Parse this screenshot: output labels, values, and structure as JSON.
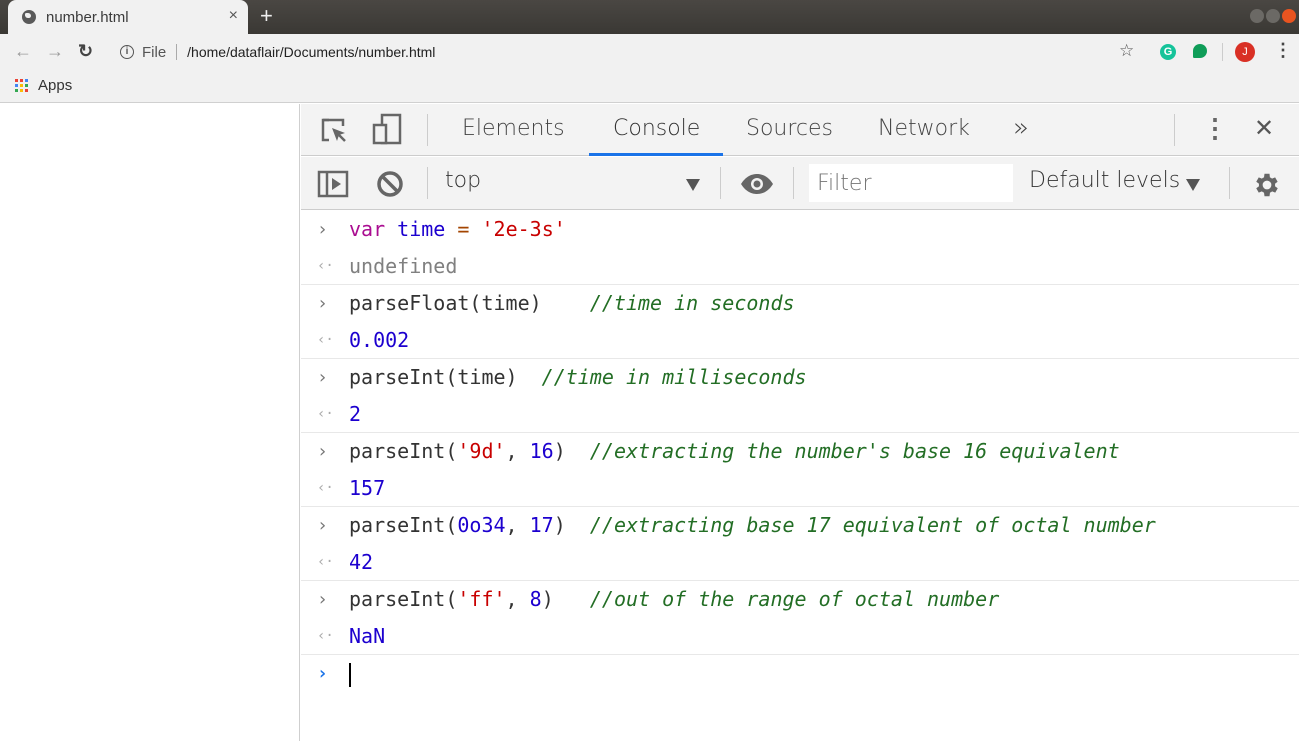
{
  "browser": {
    "tab_title": "number.html",
    "tab_close": "×",
    "new_tab": "+",
    "nav": {
      "back": "←",
      "forward": "→",
      "reload": "↻"
    },
    "omnibox": {
      "scheme_label": "File",
      "url": "/home/dataflair/Documents/number.html"
    },
    "bookmarks": {
      "apps_label": "Apps"
    },
    "extensions": {
      "profile_initial": "J"
    },
    "colors": {
      "grammarly": "#15c39a",
      "hangouts": "#0f9d58",
      "profile": "#d93025"
    }
  },
  "devtools": {
    "tabs": [
      "Elements",
      "Console",
      "Sources",
      "Network"
    ],
    "active_tab": "Console",
    "more_tabs": "»",
    "close": "✕",
    "context": "top",
    "filter_placeholder": "Filter",
    "levels": "Default levels",
    "accent": "#1a73e8"
  },
  "console": {
    "entries": [
      {
        "input": [
          [
            "kw",
            "var"
          ],
          [
            "plain",
            " "
          ],
          [
            "var",
            "time"
          ],
          [
            "plain",
            " "
          ],
          [
            "op",
            "="
          ],
          [
            "plain",
            " "
          ],
          [
            "str",
            "'2e-3s'"
          ]
        ],
        "output": "undefined",
        "output_type": "undef"
      },
      {
        "input": [
          [
            "plain",
            "parseFloat(time)    "
          ],
          [
            "cm",
            "//time in seconds"
          ]
        ],
        "output": "0.002",
        "output_type": "num"
      },
      {
        "input": [
          [
            "plain",
            "parseInt(time)  "
          ],
          [
            "cm",
            "//time in milliseconds"
          ]
        ],
        "output": "2",
        "output_type": "num"
      },
      {
        "input": [
          [
            "plain",
            "parseInt("
          ],
          [
            "str",
            "'9d'"
          ],
          [
            "plain",
            ", "
          ],
          [
            "num",
            "16"
          ],
          [
            "plain",
            ")  "
          ],
          [
            "cm",
            "//extracting the number's base 16 equivalent"
          ]
        ],
        "output": "157",
        "output_type": "num"
      },
      {
        "input": [
          [
            "plain",
            "parseInt("
          ],
          [
            "num",
            "0o34"
          ],
          [
            "plain",
            ", "
          ],
          [
            "num",
            "17"
          ],
          [
            "plain",
            ")  "
          ],
          [
            "cm",
            "//extracting base 17 equivalent of octal number"
          ]
        ],
        "output": "42",
        "output_type": "num"
      },
      {
        "input": [
          [
            "plain",
            "parseInt("
          ],
          [
            "str",
            "'ff'"
          ],
          [
            "plain",
            ", "
          ],
          [
            "num",
            "8"
          ],
          [
            "plain",
            ")   "
          ],
          [
            "cm",
            "//out of the range of octal number"
          ]
        ],
        "output": "NaN",
        "output_type": "num"
      }
    ],
    "input_prompt": "›",
    "entry_prompt": "›",
    "result_prompt": "‹·"
  }
}
